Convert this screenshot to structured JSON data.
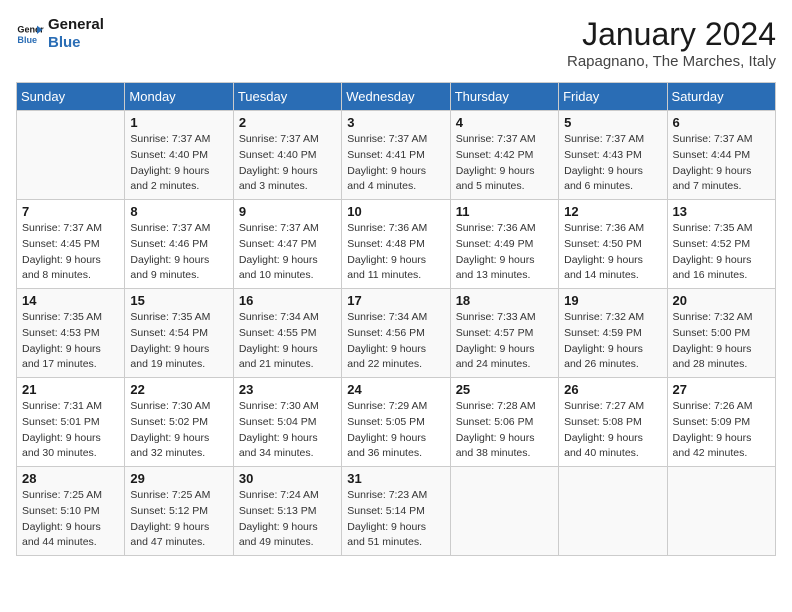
{
  "logo": {
    "line1": "General",
    "line2": "Blue"
  },
  "title": "January 2024",
  "subtitle": "Rapagnano, The Marches, Italy",
  "days_header": [
    "Sunday",
    "Monday",
    "Tuesday",
    "Wednesday",
    "Thursday",
    "Friday",
    "Saturday"
  ],
  "weeks": [
    [
      {
        "num": "",
        "detail": ""
      },
      {
        "num": "1",
        "detail": "Sunrise: 7:37 AM\nSunset: 4:40 PM\nDaylight: 9 hours\nand 2 minutes."
      },
      {
        "num": "2",
        "detail": "Sunrise: 7:37 AM\nSunset: 4:40 PM\nDaylight: 9 hours\nand 3 minutes."
      },
      {
        "num": "3",
        "detail": "Sunrise: 7:37 AM\nSunset: 4:41 PM\nDaylight: 9 hours\nand 4 minutes."
      },
      {
        "num": "4",
        "detail": "Sunrise: 7:37 AM\nSunset: 4:42 PM\nDaylight: 9 hours\nand 5 minutes."
      },
      {
        "num": "5",
        "detail": "Sunrise: 7:37 AM\nSunset: 4:43 PM\nDaylight: 9 hours\nand 6 minutes."
      },
      {
        "num": "6",
        "detail": "Sunrise: 7:37 AM\nSunset: 4:44 PM\nDaylight: 9 hours\nand 7 minutes."
      }
    ],
    [
      {
        "num": "7",
        "detail": "Sunrise: 7:37 AM\nSunset: 4:45 PM\nDaylight: 9 hours\nand 8 minutes."
      },
      {
        "num": "8",
        "detail": "Sunrise: 7:37 AM\nSunset: 4:46 PM\nDaylight: 9 hours\nand 9 minutes."
      },
      {
        "num": "9",
        "detail": "Sunrise: 7:37 AM\nSunset: 4:47 PM\nDaylight: 9 hours\nand 10 minutes."
      },
      {
        "num": "10",
        "detail": "Sunrise: 7:36 AM\nSunset: 4:48 PM\nDaylight: 9 hours\nand 11 minutes."
      },
      {
        "num": "11",
        "detail": "Sunrise: 7:36 AM\nSunset: 4:49 PM\nDaylight: 9 hours\nand 13 minutes."
      },
      {
        "num": "12",
        "detail": "Sunrise: 7:36 AM\nSunset: 4:50 PM\nDaylight: 9 hours\nand 14 minutes."
      },
      {
        "num": "13",
        "detail": "Sunrise: 7:35 AM\nSunset: 4:52 PM\nDaylight: 9 hours\nand 16 minutes."
      }
    ],
    [
      {
        "num": "14",
        "detail": "Sunrise: 7:35 AM\nSunset: 4:53 PM\nDaylight: 9 hours\nand 17 minutes."
      },
      {
        "num": "15",
        "detail": "Sunrise: 7:35 AM\nSunset: 4:54 PM\nDaylight: 9 hours\nand 19 minutes."
      },
      {
        "num": "16",
        "detail": "Sunrise: 7:34 AM\nSunset: 4:55 PM\nDaylight: 9 hours\nand 21 minutes."
      },
      {
        "num": "17",
        "detail": "Sunrise: 7:34 AM\nSunset: 4:56 PM\nDaylight: 9 hours\nand 22 minutes."
      },
      {
        "num": "18",
        "detail": "Sunrise: 7:33 AM\nSunset: 4:57 PM\nDaylight: 9 hours\nand 24 minutes."
      },
      {
        "num": "19",
        "detail": "Sunrise: 7:32 AM\nSunset: 4:59 PM\nDaylight: 9 hours\nand 26 minutes."
      },
      {
        "num": "20",
        "detail": "Sunrise: 7:32 AM\nSunset: 5:00 PM\nDaylight: 9 hours\nand 28 minutes."
      }
    ],
    [
      {
        "num": "21",
        "detail": "Sunrise: 7:31 AM\nSunset: 5:01 PM\nDaylight: 9 hours\nand 30 minutes."
      },
      {
        "num": "22",
        "detail": "Sunrise: 7:30 AM\nSunset: 5:02 PM\nDaylight: 9 hours\nand 32 minutes."
      },
      {
        "num": "23",
        "detail": "Sunrise: 7:30 AM\nSunset: 5:04 PM\nDaylight: 9 hours\nand 34 minutes."
      },
      {
        "num": "24",
        "detail": "Sunrise: 7:29 AM\nSunset: 5:05 PM\nDaylight: 9 hours\nand 36 minutes."
      },
      {
        "num": "25",
        "detail": "Sunrise: 7:28 AM\nSunset: 5:06 PM\nDaylight: 9 hours\nand 38 minutes."
      },
      {
        "num": "26",
        "detail": "Sunrise: 7:27 AM\nSunset: 5:08 PM\nDaylight: 9 hours\nand 40 minutes."
      },
      {
        "num": "27",
        "detail": "Sunrise: 7:26 AM\nSunset: 5:09 PM\nDaylight: 9 hours\nand 42 minutes."
      }
    ],
    [
      {
        "num": "28",
        "detail": "Sunrise: 7:25 AM\nSunset: 5:10 PM\nDaylight: 9 hours\nand 44 minutes."
      },
      {
        "num": "29",
        "detail": "Sunrise: 7:25 AM\nSunset: 5:12 PM\nDaylight: 9 hours\nand 47 minutes."
      },
      {
        "num": "30",
        "detail": "Sunrise: 7:24 AM\nSunset: 5:13 PM\nDaylight: 9 hours\nand 49 minutes."
      },
      {
        "num": "31",
        "detail": "Sunrise: 7:23 AM\nSunset: 5:14 PM\nDaylight: 9 hours\nand 51 minutes."
      },
      {
        "num": "",
        "detail": ""
      },
      {
        "num": "",
        "detail": ""
      },
      {
        "num": "",
        "detail": ""
      }
    ]
  ]
}
